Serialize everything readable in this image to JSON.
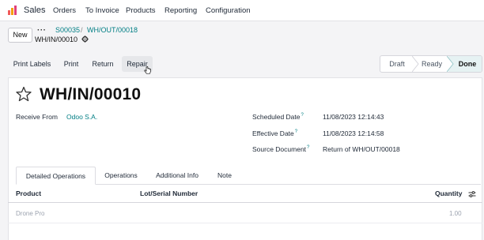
{
  "nav": {
    "app_name": "Sales",
    "items": [
      "Orders",
      "To Invoice",
      "Products",
      "Reporting",
      "Configuration"
    ]
  },
  "control": {
    "new_label": "New",
    "breadcrumb_dots": "···",
    "breadcrumb": [
      "S00035",
      "WH/OUT/00018"
    ],
    "breadcrumb_sep": "/",
    "current": "WH/IN/00010"
  },
  "actions": [
    "Print Labels",
    "Print",
    "Return",
    "Repair"
  ],
  "status": {
    "stages": [
      "Draft",
      "Ready",
      "Done"
    ],
    "active": "Done"
  },
  "record": {
    "title": "WH/IN/00010",
    "receive_from_label": "Receive From",
    "receive_from_value": "Odoo S.A.",
    "fields": [
      {
        "label": "Scheduled Date",
        "value": "11/08/2023 12:14:43"
      },
      {
        "label": "Effective Date",
        "value": "11/08/2023 12:14:58"
      },
      {
        "label": "Source Document",
        "value": "Return of WH/OUT/00018"
      }
    ],
    "help_mark": "?"
  },
  "tabs": [
    "Detailed Operations",
    "Operations",
    "Additional Info",
    "Note"
  ],
  "table": {
    "columns": [
      "Product",
      "Lot/Serial Number",
      "Quantity"
    ],
    "rows": [
      {
        "product": "Drone Pro",
        "lot": "",
        "quantity": "1.00"
      }
    ]
  },
  "colors": {
    "accent": "#017e84",
    "done_bg": "#e6f2f3"
  }
}
